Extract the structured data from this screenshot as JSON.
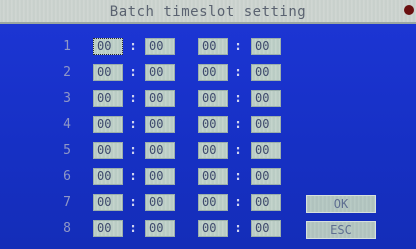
{
  "title": "Batch timeslot setting",
  "rows": [
    {
      "index": "1",
      "start_hour": "00",
      "start_min": "00",
      "end_hour": "00",
      "end_min": "00"
    },
    {
      "index": "2",
      "start_hour": "00",
      "start_min": "00",
      "end_hour": "00",
      "end_min": "00"
    },
    {
      "index": "3",
      "start_hour": "00",
      "start_min": "00",
      "end_hour": "00",
      "end_min": "00"
    },
    {
      "index": "4",
      "start_hour": "00",
      "start_min": "00",
      "end_hour": "00",
      "end_min": "00"
    },
    {
      "index": "5",
      "start_hour": "00",
      "start_min": "00",
      "end_hour": "00",
      "end_min": "00"
    },
    {
      "index": "6",
      "start_hour": "00",
      "start_min": "00",
      "end_hour": "00",
      "end_min": "00"
    },
    {
      "index": "7",
      "start_hour": "00",
      "start_min": "00",
      "end_hour": "00",
      "end_min": "00"
    },
    {
      "index": "8",
      "start_hour": "00",
      "start_min": "00",
      "end_hour": "00",
      "end_min": "00"
    }
  ],
  "separator": ":",
  "buttons": {
    "ok": "OK",
    "esc": "ESC"
  },
  "colors": {
    "background": "#1b34c8",
    "field": "#c2d3cb",
    "titlebar": "#cfd6d2"
  }
}
